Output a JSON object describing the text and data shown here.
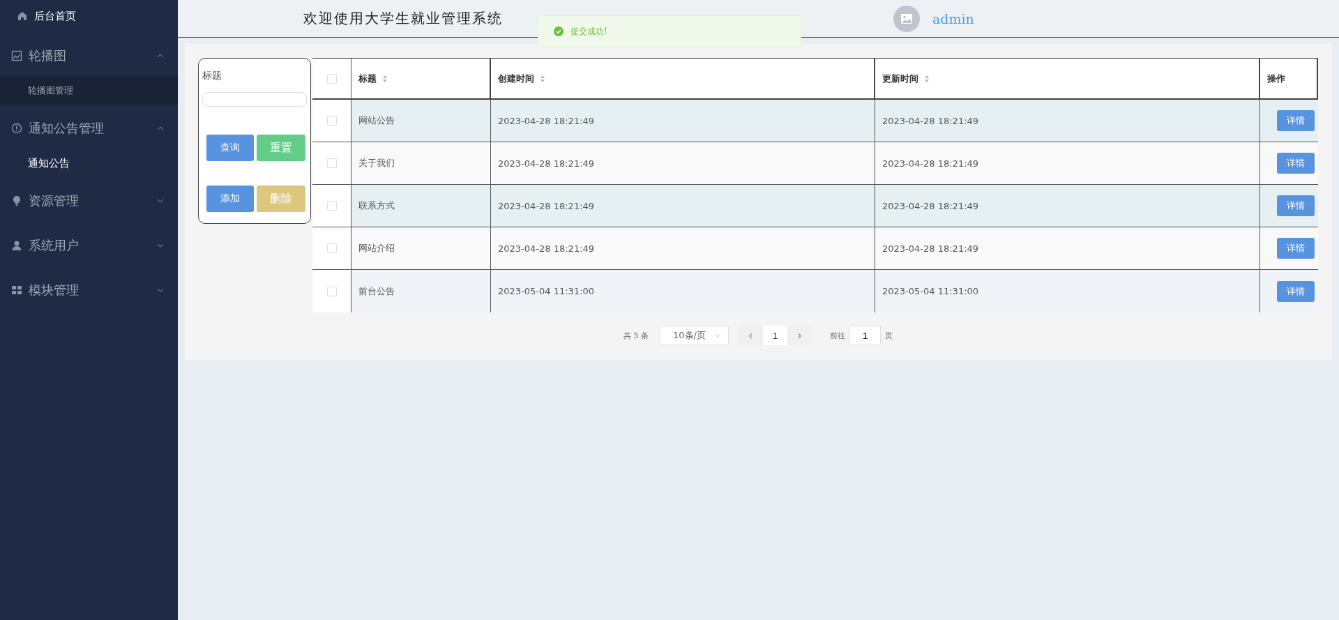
{
  "sidebar": {
    "home": {
      "label": "后台首页"
    },
    "menus": [
      {
        "label": "轮播图",
        "expanded": true,
        "children": [
          {
            "label": "轮播图管理",
            "selected": false,
            "hovered": true
          }
        ]
      },
      {
        "label": "通知公告管理",
        "expanded": true,
        "children": [
          {
            "label": "通知公告",
            "selected": true,
            "hovered": false
          }
        ]
      },
      {
        "label": "资源管理",
        "expanded": false
      },
      {
        "label": "系统用户",
        "expanded": false
      },
      {
        "label": "模块管理",
        "expanded": false
      }
    ]
  },
  "header": {
    "title": "欢迎使用大学生就业管理系统",
    "user": "admin"
  },
  "toast": {
    "message": "提交成功!"
  },
  "filter": {
    "label": "标题",
    "buttons": [
      {
        "label": "查询",
        "kind": "primary"
      },
      {
        "label": "重置",
        "kind": "success"
      },
      {
        "label": "添加",
        "kind": "primary"
      },
      {
        "label": "删除",
        "kind": "warning"
      }
    ]
  },
  "table": {
    "select_all_checked": false,
    "columns": [
      {
        "label": "标题",
        "sortable": true
      },
      {
        "label": "创建时间",
        "sortable": true
      },
      {
        "label": "更新时间",
        "sortable": true
      },
      {
        "label": "操作",
        "sortable": false
      }
    ],
    "rows": [
      {
        "checked": false,
        "hovered": false,
        "title": "网站公告",
        "created": "2023-04-28 18:21:49",
        "updated": "2023-04-28 18:21:49",
        "action": "详情"
      },
      {
        "checked": false,
        "hovered": false,
        "title": "关于我们",
        "created": "2023-04-28 18:21:49",
        "updated": "2023-04-28 18:21:49",
        "action": "详情"
      },
      {
        "checked": false,
        "hovered": false,
        "title": "联系方式",
        "created": "2023-04-28 18:21:49",
        "updated": "2023-04-28 18:21:49",
        "action": "详情"
      },
      {
        "checked": false,
        "hovered": false,
        "title": "网站介绍",
        "created": "2023-04-28 18:21:49",
        "updated": "2023-04-28 18:21:49",
        "action": "详情"
      },
      {
        "checked": false,
        "hovered": true,
        "title": "前台公告",
        "created": "2023-05-04 11:31:00",
        "updated": "2023-05-04 11:31:00",
        "action": "详情"
      }
    ]
  },
  "pagination": {
    "total": "共 5 条",
    "page_size": "10条/页",
    "prev": "‹",
    "page": "1",
    "next": "›",
    "goto_label": "前往",
    "goto_value": "1",
    "goto_suffix": "页"
  }
}
